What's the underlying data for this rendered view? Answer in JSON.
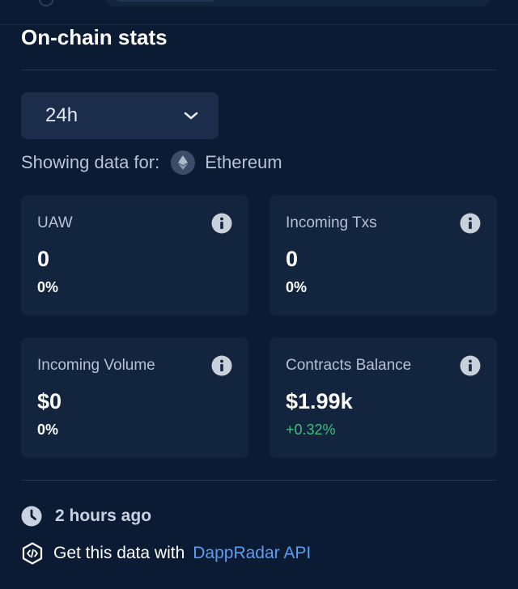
{
  "section": {
    "title": "On-chain stats"
  },
  "timeframe": {
    "selected": "24h"
  },
  "chain": {
    "prefix": "Showing data for:",
    "name": "Ethereum"
  },
  "stats": [
    {
      "label": "UAW",
      "value": "0",
      "change": "0%"
    },
    {
      "label": "Incoming Txs",
      "value": "0",
      "change": "0%"
    },
    {
      "label": "Incoming Volume",
      "value": "$0",
      "change": "0%"
    },
    {
      "label": "Contracts Balance",
      "value": "$1.99k",
      "change": "+0.32%"
    }
  ],
  "footer": {
    "updated": "2 hours ago",
    "api_text": "Get this data with",
    "api_link": "DappRadar API"
  },
  "colors": {
    "background": "#0b1b33",
    "card": "#13243f",
    "positive": "#3fbf7f",
    "link": "#5e9df0"
  },
  "icons": {
    "chevron": "chevron-down-icon",
    "chain": "ethereum-icon",
    "info": "info-icon",
    "clock": "clock-icon",
    "api": "code-icon"
  }
}
